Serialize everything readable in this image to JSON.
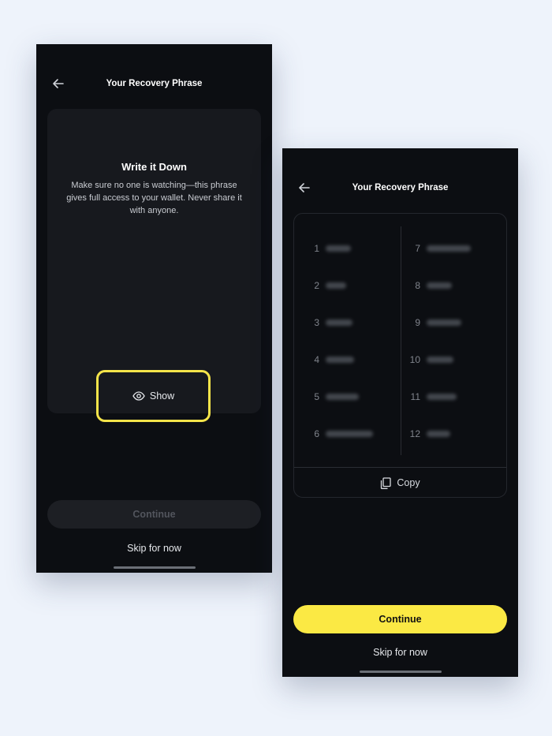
{
  "left_screen": {
    "header": {
      "title": "Your Recovery Phrase"
    },
    "card": {
      "title": "Write it Down",
      "description": "Make sure no one is watching—this phrase gives full access to your wallet. Never share it with anyone."
    },
    "show_button": {
      "label": "Show",
      "icon": "eye-icon"
    },
    "continue_button": {
      "label": "Continue",
      "state": "disabled"
    },
    "skip_link": "Skip for now"
  },
  "right_screen": {
    "header": {
      "title": "Your Recovery Phrase"
    },
    "phrase_words": [
      {
        "number": "1"
      },
      {
        "number": "2"
      },
      {
        "number": "3"
      },
      {
        "number": "4"
      },
      {
        "number": "5"
      },
      {
        "number": "6"
      },
      {
        "number": "7"
      },
      {
        "number": "8"
      },
      {
        "number": "9"
      },
      {
        "number": "10"
      },
      {
        "number": "11"
      },
      {
        "number": "12"
      }
    ],
    "copy_button": {
      "label": "Copy",
      "icon": "copy-icon"
    },
    "continue_button": {
      "label": "Continue",
      "state": "enabled"
    },
    "skip_link": "Skip for now"
  },
  "colors": {
    "screen_background": "#0c0e12",
    "page_background": "#eef3fb",
    "accent_yellow": "#fbe944",
    "highlight_outline": "#f5e44a"
  }
}
